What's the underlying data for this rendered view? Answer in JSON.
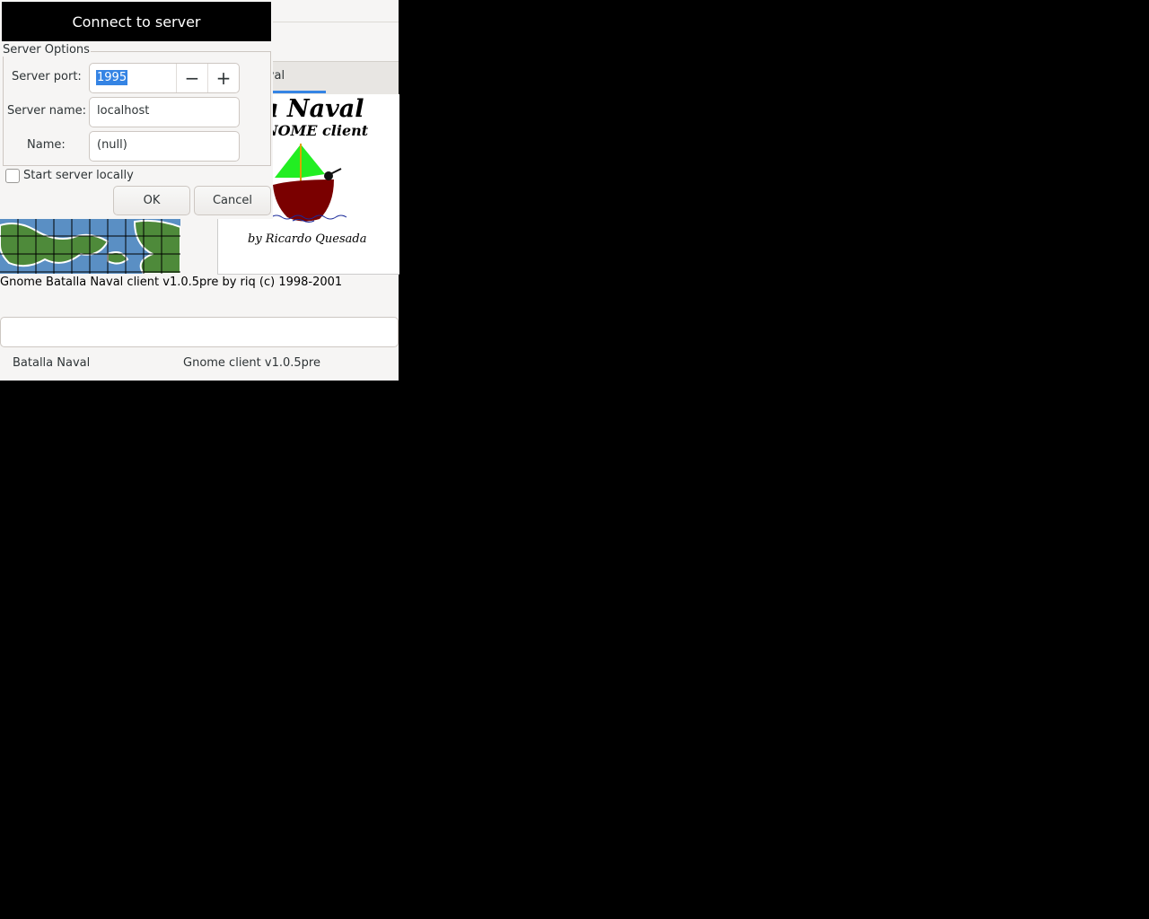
{
  "dialog": {
    "title": "Connect to server",
    "frame_label": "Server Options",
    "port_label": "Server port:",
    "port_value": "1995",
    "name_label": "Server name:",
    "name_value": "localhost",
    "user_label": "Name:",
    "user_value": "(null)",
    "start_local_label": "Start server locally",
    "start_local_checked": false,
    "ok_label": "OK",
    "cancel_label": "Cancel",
    "minus_glyph": "−",
    "plus_glyph": "+"
  },
  "main": {
    "tab_label": "a Naval",
    "logo": {
      "line1": "alla Naval",
      "line2": "NOME client",
      "credit": "by Ricardo Quesada"
    },
    "status_text": "Gnome Batalla Naval client v1.0.5pre by riq (c) 1998-2001",
    "entry_value": "",
    "statusbar": {
      "left": "Batalla Naval",
      "right": "Gnome client v1.0.5pre"
    }
  },
  "colors": {
    "accent": "#3584e4",
    "sail": "#22ee22",
    "hull": "#7a0000",
    "sea": "#4a7fb5",
    "land": "#4e8a3a"
  }
}
